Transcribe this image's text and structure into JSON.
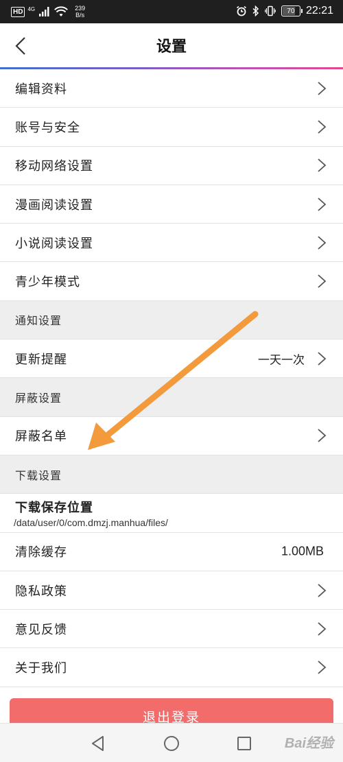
{
  "status_bar": {
    "hd": "HD",
    "net": "4G",
    "speed_value": "239",
    "speed_unit": "B/s",
    "battery": "70",
    "time": "22:21"
  },
  "header": {
    "title": "设置"
  },
  "items": {
    "edit_profile": "编辑资料",
    "account_security": "账号与安全",
    "mobile_network": "移动网络设置",
    "comic_reading": "漫画阅读设置",
    "novel_reading": "小说阅读设置",
    "teen_mode": "青少年模式",
    "notify_section": "通知设置",
    "update_reminder": "更新提醒",
    "update_reminder_value": "一天一次",
    "block_section": "屏蔽设置",
    "block_list": "屏蔽名单",
    "download_section": "下载设置",
    "download_location": "下载保存位置",
    "download_path": "/data/user/0/com.dmzj.manhua/files/",
    "clear_cache": "清除缓存",
    "cache_size": "1.00MB",
    "privacy_policy": "隐私政策",
    "feedback": "意见反馈",
    "about_us": "关于我们"
  },
  "logout_label": "退出登录",
  "watermark": "Bai经验",
  "colors": {
    "accent_gradient_start": "#3f6fd6",
    "accent_gradient_end": "#e0488f",
    "logout_button": "#f26c6c",
    "annotation_arrow": "#f39a3d"
  }
}
